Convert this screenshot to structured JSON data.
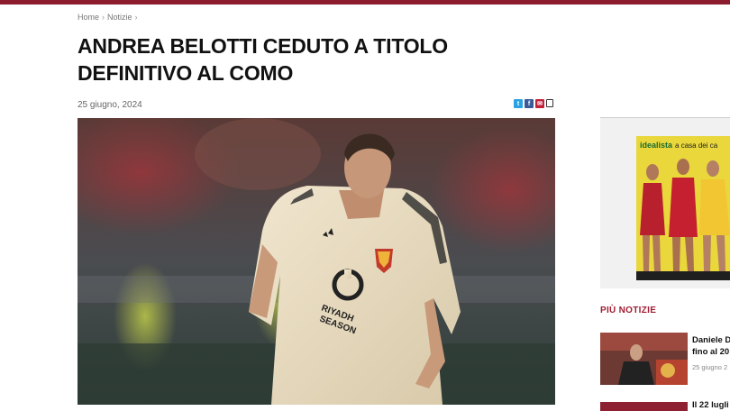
{
  "breadcrumb": {
    "home": "Home",
    "section": "Notizie"
  },
  "article": {
    "title_line1": "ANDREA BELOTTI CEDUTO A TITOLO",
    "title_line2": "DEFINITIVO AL COMO",
    "date": "25 giugno, 2024",
    "image": {
      "kit_sponsor_line1": "RIYADH",
      "kit_sponsor_line2": "SEASON"
    }
  },
  "share": {
    "twitter": "t",
    "facebook": "f",
    "email": "✉",
    "copy": ""
  },
  "sidebar": {
    "ad": {
      "brand": "idealista",
      "tagline": "a casa dei ca"
    },
    "more_news_heading": "PIÙ NOTIZIE",
    "news": [
      {
        "title_line1": "Daniele D",
        "title_line2": "fino al 20",
        "date": "25 giugno 2"
      },
      {
        "title_line1": "Il 22 lugli"
      }
    ]
  },
  "colors": {
    "brand": "#8a1c2e",
    "accent": "#a01c32",
    "ad_yellow": "#e9d73b"
  }
}
